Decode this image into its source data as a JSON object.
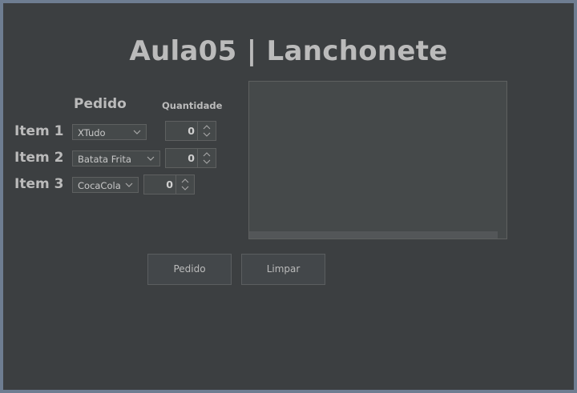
{
  "window": {
    "title": "Aula05 | Lanchonete"
  },
  "headers": {
    "pedido": "Pedido",
    "quantidade": "Quantidade"
  },
  "items": [
    {
      "label": "Item 1",
      "selected": "XTudo",
      "quantity": "0"
    },
    {
      "label": "Item 2",
      "selected": "Batata Frita",
      "quantity": "0"
    },
    {
      "label": "Item 3",
      "selected": "CocaCola",
      "quantity": "0"
    }
  ],
  "output": {
    "text": ""
  },
  "buttons": {
    "pedido": "Pedido",
    "limpar": "Limpar"
  },
  "colors": {
    "background": "#3c3f41",
    "border": "#6e7d91",
    "field": "#45494a",
    "text": "#bbbbbb"
  }
}
